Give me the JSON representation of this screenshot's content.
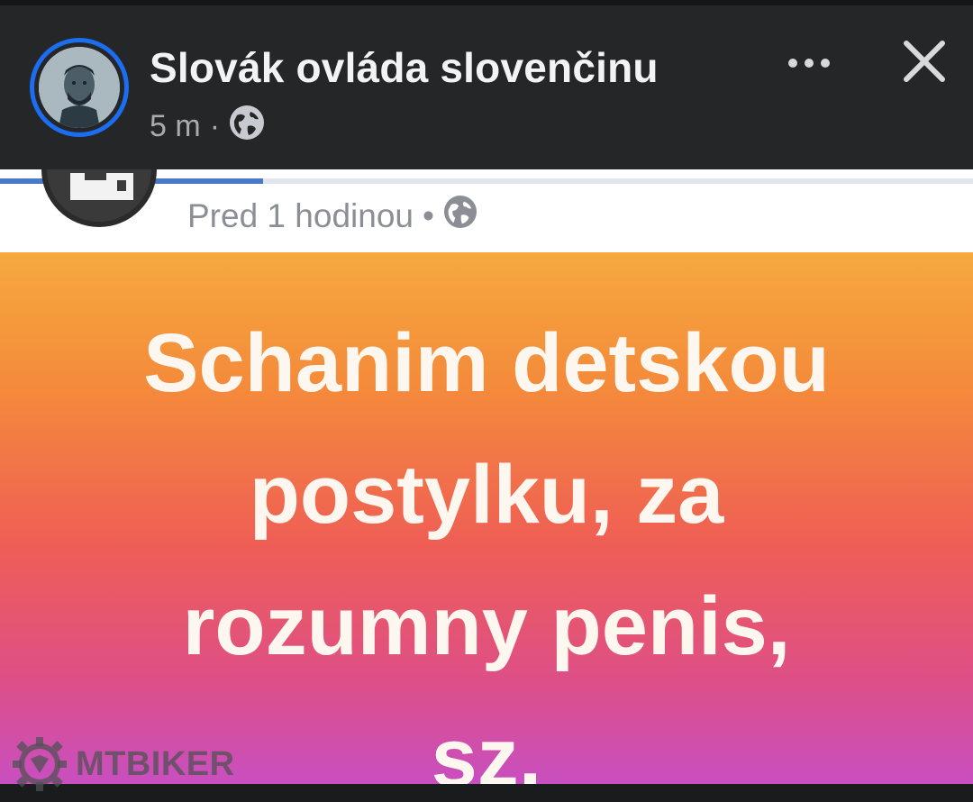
{
  "header": {
    "page_name": "Slovák ovláda slovenčinu",
    "time": "5 m",
    "separator": "·",
    "privacy_icon": "globe-icon",
    "more_icon": "more-dots-icon",
    "close_icon": "close-icon",
    "accent_color": "#1b6ef2"
  },
  "post": {
    "inner_time": "Pred 1 hodinou",
    "inner_separator": "•",
    "inner_privacy_icon": "globe-icon",
    "progress_fraction": 0.27,
    "lines": [
      "Schanim detskou",
      "postylku, za",
      "rozumny penis,",
      "sz."
    ]
  },
  "watermark": {
    "text": "MTBIKER"
  }
}
